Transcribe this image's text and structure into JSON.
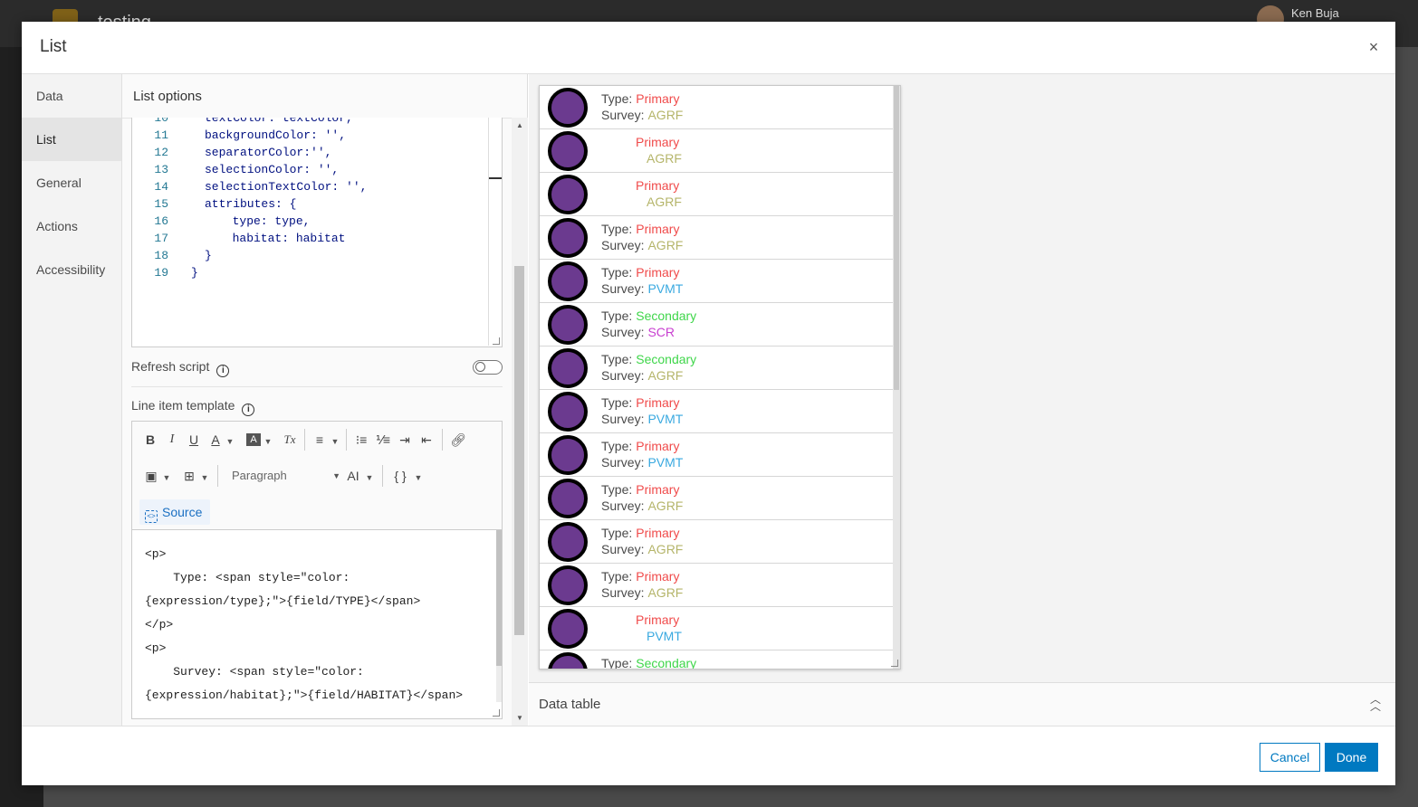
{
  "background": {
    "app_title": "testing",
    "user_name": "Ken Buja"
  },
  "modal": {
    "title": "List",
    "close_icon": "×"
  },
  "nav": {
    "items": [
      {
        "label": "Data"
      },
      {
        "label": "List"
      },
      {
        "label": "General"
      },
      {
        "label": "Actions"
      },
      {
        "label": "Accessibility"
      }
    ],
    "active": "List"
  },
  "options": {
    "title": "List options",
    "refresh_label": "Refresh script",
    "template_label": "Line item template",
    "refresh_enabled": false,
    "code_lines": [
      {
        "n": "10",
        "t": "textColor: textColor,"
      },
      {
        "n": "11",
        "t": "backgroundColor: '',"
      },
      {
        "n": "12",
        "t": "separatorColor:'',"
      },
      {
        "n": "13",
        "t": "selectionColor: '',"
      },
      {
        "n": "14",
        "t": "selectionTextColor: '',"
      },
      {
        "n": "15",
        "t": "attributes: {"
      },
      {
        "n": "16",
        "t": "  type: type,"
      },
      {
        "n": "17",
        "t": "  habitat: habitat"
      },
      {
        "n": "18",
        "t": "}"
      },
      {
        "n": "19",
        "t": "}"
      }
    ],
    "toolbar": {
      "bold": "B",
      "italic": "I",
      "underline": "U",
      "font_color": "A",
      "bg_color": "A",
      "clear_format": "Tx",
      "paragraph": "Paragraph",
      "font_size": "AI",
      "braces": "{ }",
      "source": "Source"
    },
    "source_text": "<p>\n    Type: <span style=\"color: {expression/type};\">{field/TYPE}</span>\n</p>\n<p>\n    Survey: <span style=\"color: {expression/habitat};\">{field/HABITAT}</span>"
  },
  "preview": {
    "colors": {
      "Primary": "#f04b4b",
      "Secondary": "#3fd64a",
      "AGRF": "#b5b56a",
      "PVMT": "#39a9e0",
      "SCR": "#c83fd0"
    },
    "items": [
      {
        "type_label": "Type:",
        "type": "Primary",
        "survey_label": "Survey:",
        "survey": "AGRF"
      },
      {
        "type_label": "",
        "type": "Primary",
        "survey_label": "",
        "survey": "AGRF"
      },
      {
        "type_label": "",
        "type": "Primary",
        "survey_label": "",
        "survey": "AGRF"
      },
      {
        "type_label": "Type:",
        "type": "Primary",
        "survey_label": "Survey:",
        "survey": "AGRF"
      },
      {
        "type_label": "Type:",
        "type": "Primary",
        "survey_label": "Survey:",
        "survey": "PVMT"
      },
      {
        "type_label": "Type:",
        "type": "Secondary",
        "survey_label": "Survey:",
        "survey": "SCR"
      },
      {
        "type_label": "Type:",
        "type": "Secondary",
        "survey_label": "Survey:",
        "survey": "AGRF"
      },
      {
        "type_label": "Type:",
        "type": "Primary",
        "survey_label": "Survey:",
        "survey": "PVMT"
      },
      {
        "type_label": "Type:",
        "type": "Primary",
        "survey_label": "Survey:",
        "survey": "PVMT"
      },
      {
        "type_label": "Type:",
        "type": "Primary",
        "survey_label": "Survey:",
        "survey": "AGRF"
      },
      {
        "type_label": "Type:",
        "type": "Primary",
        "survey_label": "Survey:",
        "survey": "AGRF"
      },
      {
        "type_label": "Type:",
        "type": "Primary",
        "survey_label": "Survey:",
        "survey": "AGRF"
      },
      {
        "type_label": "",
        "type": "Primary",
        "survey_label": "",
        "survey": "PVMT"
      },
      {
        "type_label": "Type:",
        "type": "Secondary",
        "survey_label": "",
        "survey": ""
      }
    ],
    "data_table_label": "Data table"
  },
  "footer": {
    "cancel": "Cancel",
    "done": "Done"
  }
}
